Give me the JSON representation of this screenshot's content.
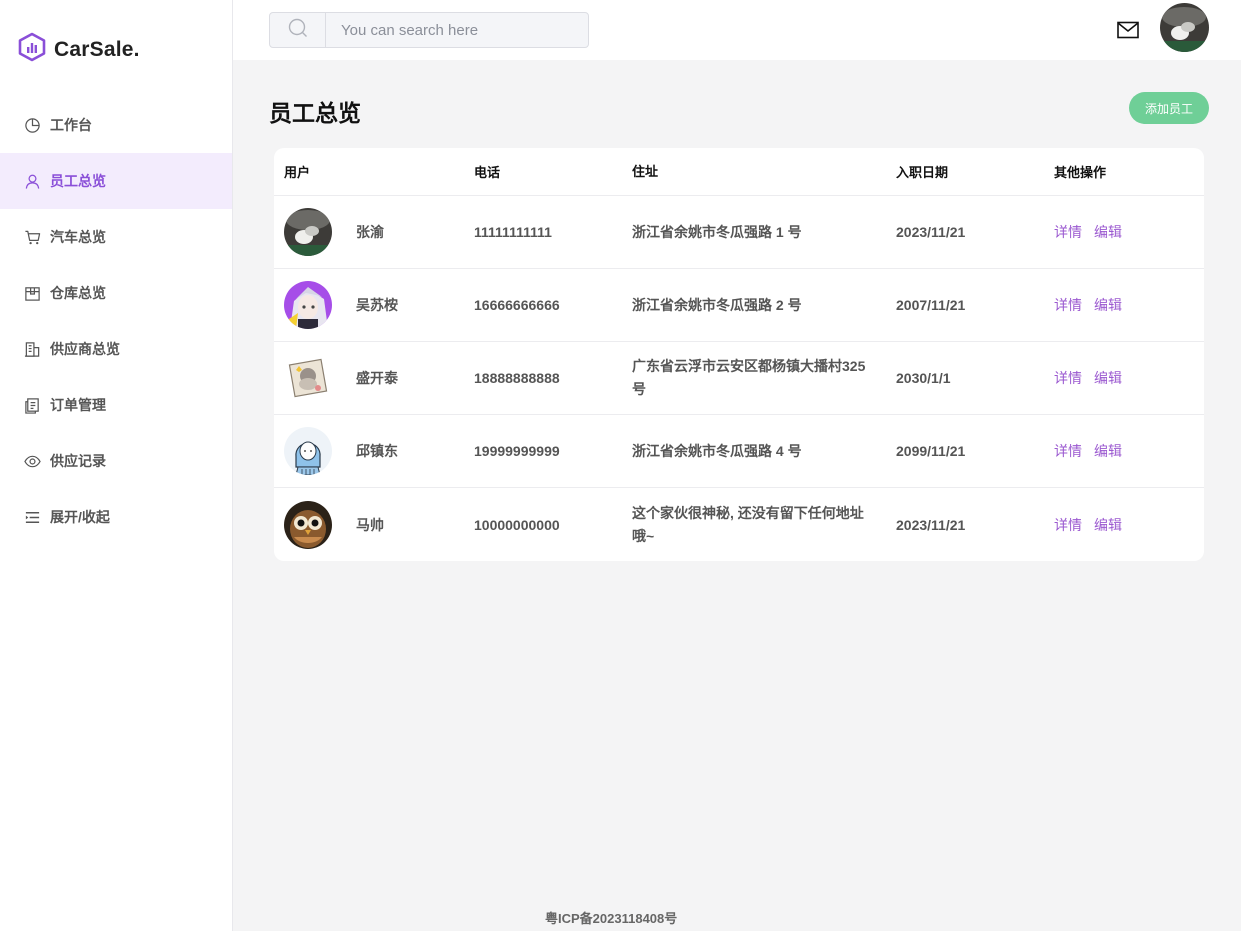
{
  "app": {
    "logo_text": "CarSale."
  },
  "sidebar": {
    "items": [
      {
        "label": "工作台",
        "icon": "pie-chart-icon",
        "active": false
      },
      {
        "label": "员工总览",
        "icon": "user-icon",
        "active": true
      },
      {
        "label": "汽车总览",
        "icon": "cart-icon",
        "active": false
      },
      {
        "label": "仓库总览",
        "icon": "box-icon",
        "active": false
      },
      {
        "label": "供应商总览",
        "icon": "building-icon",
        "active": false
      },
      {
        "label": "订单管理",
        "icon": "document-icon",
        "active": false
      },
      {
        "label": "供应记录",
        "icon": "eye-icon",
        "active": false
      },
      {
        "label": "展开/收起",
        "icon": "list-toggle-icon",
        "active": false
      }
    ]
  },
  "header": {
    "search_placeholder": "You can search here",
    "search_value": ""
  },
  "main": {
    "title": "员工总览",
    "add_button": "添加员工",
    "table": {
      "columns": [
        "用户",
        "电话",
        "住址",
        "入职日期",
        "其他操作"
      ],
      "rows": [
        {
          "name": "张渝",
          "phone": "11111111111",
          "address": "浙江省余姚市冬瓜强路 1 号",
          "date": "2023/11/21",
          "avatar": "dark-photo-avatar",
          "op_detail": "详情",
          "op_edit": "编辑"
        },
        {
          "name": "吴苏桉",
          "phone": "16666666666",
          "address": "浙江省余姚市冬瓜强路 2 号",
          "date": "2007/11/21",
          "avatar": "anime-purple-avatar",
          "op_detail": "详情",
          "op_edit": "编辑"
        },
        {
          "name": "盛开泰",
          "phone": "18888888888",
          "address": "广东省云浮市云安区都杨镇大播村325号",
          "date": "2030/1/1",
          "avatar": "sticker-cat-avatar",
          "op_detail": "详情",
          "op_edit": "编辑"
        },
        {
          "name": "邱镇东",
          "phone": "19999999999",
          "address": "浙江省余姚市冬瓜强路 4 号",
          "date": "2099/11/21",
          "avatar": "blue-girl-avatar",
          "op_detail": "详情",
          "op_edit": "编辑"
        },
        {
          "name": "马帅",
          "phone": "10000000000",
          "address": "这个家伙很神秘, 还没有留下任何地址哦~",
          "date": "2023/11/21",
          "avatar": "owl-avatar",
          "op_detail": "详情",
          "op_edit": "编辑"
        }
      ]
    }
  },
  "footer": {
    "icp": "粤ICP备2023118408号"
  },
  "colors": {
    "accent": "#8a4fd8",
    "active_bg": "#f3ecfd",
    "add_button": "#6fcf97",
    "link": "#9b59d0"
  }
}
